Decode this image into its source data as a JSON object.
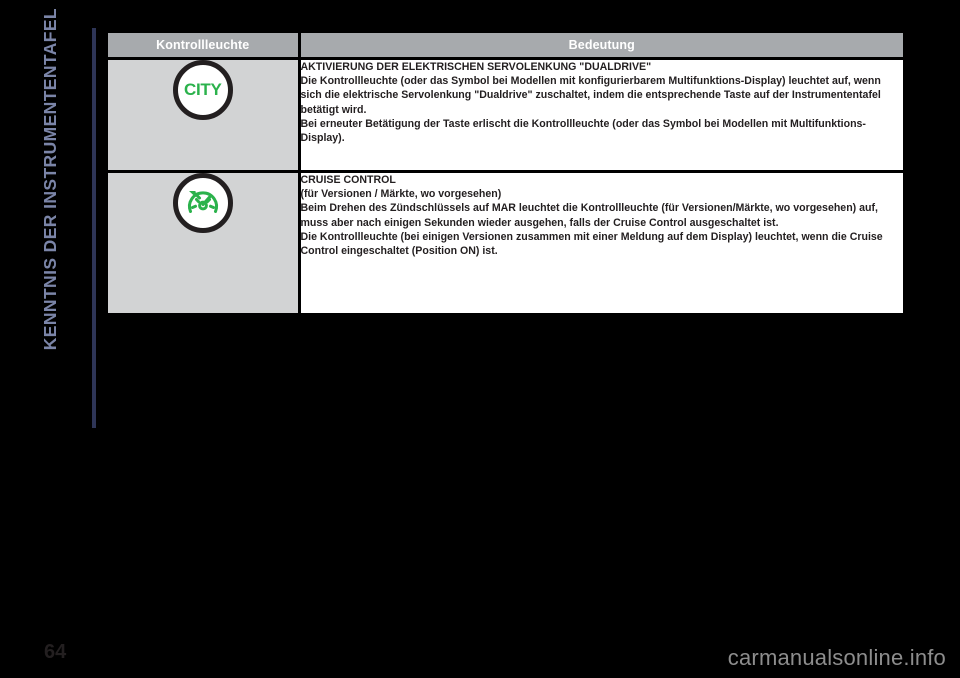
{
  "chapter": {
    "title": "KENNTNIS DER INSTRUMENTENTAFEL",
    "accent_color": "#7b85a8",
    "rule_color": "#2e3557"
  },
  "table": {
    "headers": {
      "icon": "Kontrollleuchte",
      "meaning": "Bedeutung"
    },
    "header_bg": "#a7aaad",
    "header_text_color": "#ffffff",
    "icon_cell_bg": "#d2d3d4",
    "meaning_cell_bg": "#ffffff",
    "rows": [
      {
        "icon_name": "city-steering-tell-tale-icon",
        "icon_label": "CITY",
        "icon_color": "#2bb24c",
        "title": "AKTIVIERUNG DER ELEKTRISCHEN SERVOLENKUNG \"DUALDRIVE\"",
        "paragraphs": [
          "Die Kontrollleuchte (oder das Symbol bei Modellen mit konfigurierbarem Multifunktions-Display) leuchtet auf, wenn sich die elektrische Servolenkung \"Dualdrive\" zuschaltet, indem die entsprechende Taste auf der Instrumententafel betätigt wird.",
          "Bei erneuter Betätigung der Taste erlischt die Kontrollleuchte (oder das Symbol bei Modellen mit Multifunktions-Display)."
        ]
      },
      {
        "icon_name": "cruise-control-tell-tale-icon",
        "icon_label": "",
        "icon_color": "#2bb24c",
        "title": "CRUISE CONTROL",
        "subtitle": "(für Versionen / Märkte, wo vorgesehen)",
        "paragraphs": [
          "Beim Drehen des Zündschlüssels auf MAR leuchtet die Kontrollleuchte (für Versionen/Märkte, wo vorgesehen) auf, muss aber nach einigen Sekunden wieder ausgehen, falls der Cruise Control ausgeschaltet ist.",
          "Die Kontrollleuchte (bei einigen Versionen zusammen mit einer Meldung auf dem Display) leuchtet, wenn die Cruise Control eingeschaltet (Position ON) ist."
        ]
      }
    ]
  },
  "footer": {
    "page_number": "64",
    "watermark": "carmanualsonline.info"
  }
}
